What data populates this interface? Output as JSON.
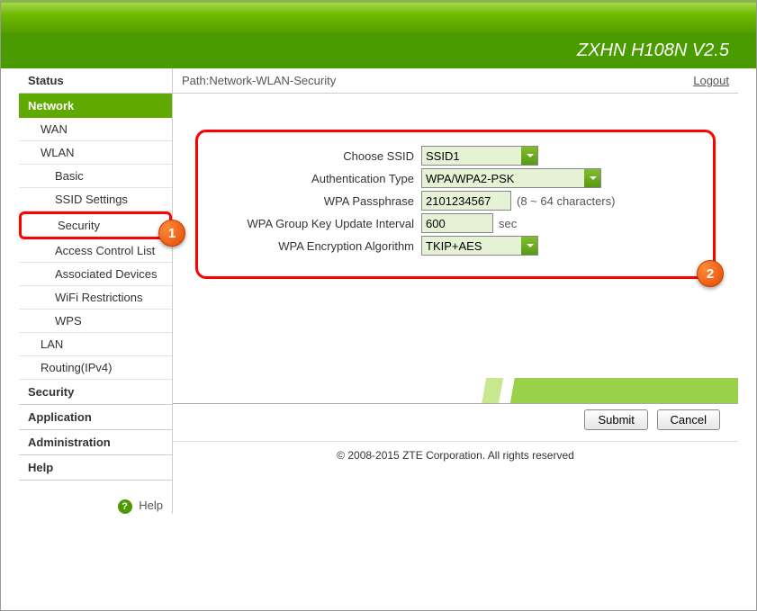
{
  "header": {
    "title": "ZXHN H108N V2.5"
  },
  "path": {
    "text": "Path:Network-WLAN-Security",
    "logout": "Logout"
  },
  "sidebar": {
    "items": [
      "Status",
      "Network",
      "WAN",
      "WLAN",
      "Basic",
      "SSID Settings",
      "Security",
      "Access Control List",
      "Associated Devices",
      "WiFi Restrictions",
      "WPS",
      "LAN",
      "Routing(IPv4)",
      "Security",
      "Application",
      "Administration",
      "Help"
    ],
    "helpLabel": "Help"
  },
  "form": {
    "ssid": {
      "label": "Choose SSID",
      "value": "SSID1"
    },
    "auth": {
      "label": "Authentication Type",
      "value": "WPA/WPA2-PSK"
    },
    "pass": {
      "label": "WPA Passphrase",
      "value": "2101234567",
      "hint": "(8 ~ 64 characters)"
    },
    "gkui": {
      "label": "WPA Group Key Update Interval",
      "value": "600",
      "unit": "sec"
    },
    "enc": {
      "label": "WPA Encryption Algorithm",
      "value": "TKIP+AES"
    }
  },
  "badges": {
    "one": "1",
    "two": "2"
  },
  "buttons": {
    "submit": "Submit",
    "cancel": "Cancel"
  },
  "footer": {
    "copyright": "© 2008-2015 ZTE Corporation. All rights reserved"
  }
}
